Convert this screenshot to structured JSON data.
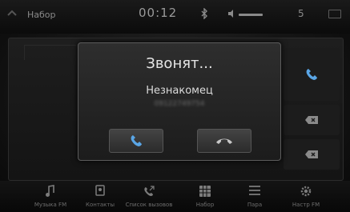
{
  "status_bar": {
    "title": "Набор",
    "time": "00:12",
    "signal": "5"
  },
  "dialog": {
    "title": "Звонят...",
    "caller_name": "Незнакомец",
    "caller_number": "09122749754"
  },
  "bottom_nav": [
    {
      "label": "Музыка FM",
      "icon": "music-note-icon"
    },
    {
      "label": "Контакты",
      "icon": "contacts-icon"
    },
    {
      "label": "Список вызовов",
      "icon": "call-log-icon"
    },
    {
      "label": "Набор",
      "icon": "keypad-icon"
    },
    {
      "label": "Пара",
      "icon": "pair-list-icon"
    },
    {
      "label": "Настр FM",
      "icon": "settings-icon"
    }
  ],
  "colors": {
    "background": "#151515",
    "dialog_border": "#5c5c5c",
    "text_primary": "#e6e6e6",
    "icon_blue": "#5aa6e6"
  }
}
